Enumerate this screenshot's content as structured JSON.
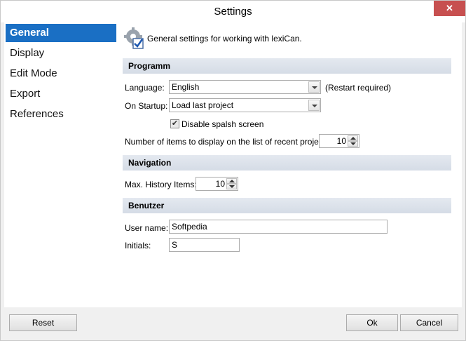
{
  "window": {
    "title": "Settings",
    "close_glyph": "✕"
  },
  "sidebar": {
    "items": [
      {
        "label": "General",
        "active": true
      },
      {
        "label": "Display",
        "active": false
      },
      {
        "label": "Edit Mode",
        "active": false
      },
      {
        "label": "Export",
        "active": false
      },
      {
        "label": "References",
        "active": false
      }
    ]
  },
  "header": {
    "icon": "gear-check-icon",
    "text": "General settings for working with lexiCan."
  },
  "programm": {
    "title": "Programm",
    "language_label": "Language:",
    "language_value": "English",
    "restart_note": "(Restart required)",
    "startup_label": "On Startup:",
    "startup_value": "Load last project",
    "splash_checkbox_label": "Disable spalsh screen",
    "splash_checked": true,
    "recent_label": "Number of items to display on the list of recent projects:",
    "recent_value": "10"
  },
  "navigation": {
    "title": "Navigation",
    "history_label": "Max. History Items:",
    "history_value": "10"
  },
  "benutzer": {
    "title": "Benutzer",
    "username_label": "User name:",
    "username_value": "Softpedia",
    "initials_label": "Initials:",
    "initials_value": "S"
  },
  "footer": {
    "reset_label": "Reset",
    "ok_label": "Ok",
    "cancel_label": "Cancel"
  },
  "colors": {
    "accent": "#1a6fc4",
    "close": "#c75050",
    "section_bg": "#dbe1ea"
  }
}
